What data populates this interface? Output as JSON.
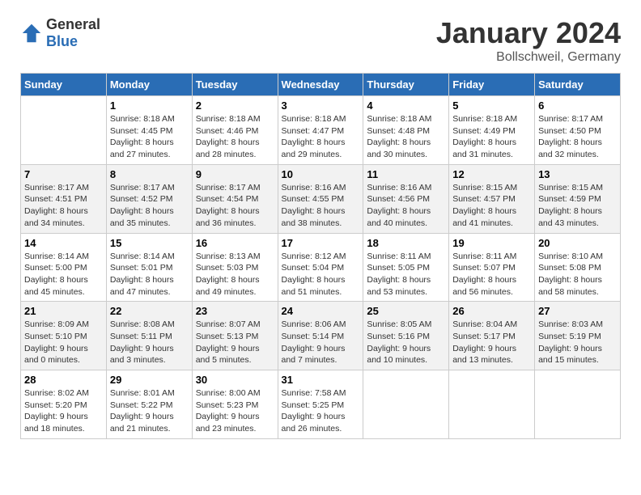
{
  "header": {
    "logo_general": "General",
    "logo_blue": "Blue",
    "title": "January 2024",
    "subtitle": "Bollschweil, Germany"
  },
  "days_of_week": [
    "Sunday",
    "Monday",
    "Tuesday",
    "Wednesday",
    "Thursday",
    "Friday",
    "Saturday"
  ],
  "weeks": [
    [
      {
        "day": "",
        "info": ""
      },
      {
        "day": "1",
        "info": "Sunrise: 8:18 AM\nSunset: 4:45 PM\nDaylight: 8 hours\nand 27 minutes."
      },
      {
        "day": "2",
        "info": "Sunrise: 8:18 AM\nSunset: 4:46 PM\nDaylight: 8 hours\nand 28 minutes."
      },
      {
        "day": "3",
        "info": "Sunrise: 8:18 AM\nSunset: 4:47 PM\nDaylight: 8 hours\nand 29 minutes."
      },
      {
        "day": "4",
        "info": "Sunrise: 8:18 AM\nSunset: 4:48 PM\nDaylight: 8 hours\nand 30 minutes."
      },
      {
        "day": "5",
        "info": "Sunrise: 8:18 AM\nSunset: 4:49 PM\nDaylight: 8 hours\nand 31 minutes."
      },
      {
        "day": "6",
        "info": "Sunrise: 8:17 AM\nSunset: 4:50 PM\nDaylight: 8 hours\nand 32 minutes."
      }
    ],
    [
      {
        "day": "7",
        "info": ""
      },
      {
        "day": "8",
        "info": "Sunrise: 8:17 AM\nSunset: 4:52 PM\nDaylight: 8 hours\nand 35 minutes."
      },
      {
        "day": "9",
        "info": "Sunrise: 8:17 AM\nSunset: 4:54 PM\nDaylight: 8 hours\nand 36 minutes."
      },
      {
        "day": "10",
        "info": "Sunrise: 8:16 AM\nSunset: 4:55 PM\nDaylight: 8 hours\nand 38 minutes."
      },
      {
        "day": "11",
        "info": "Sunrise: 8:16 AM\nSunset: 4:56 PM\nDaylight: 8 hours\nand 40 minutes."
      },
      {
        "day": "12",
        "info": "Sunrise: 8:15 AM\nSunset: 4:57 PM\nDaylight: 8 hours\nand 41 minutes."
      },
      {
        "day": "13",
        "info": "Sunrise: 8:15 AM\nSunset: 4:59 PM\nDaylight: 8 hours\nand 43 minutes."
      }
    ],
    [
      {
        "day": "14",
        "info": "Sunrise: 8:14 AM\nSunset: 5:00 PM\nDaylight: 8 hours\nand 45 minutes."
      },
      {
        "day": "15",
        "info": "Sunrise: 8:14 AM\nSunset: 5:01 PM\nDaylight: 8 hours\nand 47 minutes."
      },
      {
        "day": "16",
        "info": "Sunrise: 8:13 AM\nSunset: 5:03 PM\nDaylight: 8 hours\nand 49 minutes."
      },
      {
        "day": "17",
        "info": "Sunrise: 8:12 AM\nSunset: 5:04 PM\nDaylight: 8 hours\nand 51 minutes."
      },
      {
        "day": "18",
        "info": "Sunrise: 8:11 AM\nSunset: 5:05 PM\nDaylight: 8 hours\nand 53 minutes."
      },
      {
        "day": "19",
        "info": "Sunrise: 8:11 AM\nSunset: 5:07 PM\nDaylight: 8 hours\nand 56 minutes."
      },
      {
        "day": "20",
        "info": "Sunrise: 8:10 AM\nSunset: 5:08 PM\nDaylight: 8 hours\nand 58 minutes."
      }
    ],
    [
      {
        "day": "21",
        "info": "Sunrise: 8:09 AM\nSunset: 5:10 PM\nDaylight: 9 hours\nand 0 minutes."
      },
      {
        "day": "22",
        "info": "Sunrise: 8:08 AM\nSunset: 5:11 PM\nDaylight: 9 hours\nand 3 minutes."
      },
      {
        "day": "23",
        "info": "Sunrise: 8:07 AM\nSunset: 5:13 PM\nDaylight: 9 hours\nand 5 minutes."
      },
      {
        "day": "24",
        "info": "Sunrise: 8:06 AM\nSunset: 5:14 PM\nDaylight: 9 hours\nand 7 minutes."
      },
      {
        "day": "25",
        "info": "Sunrise: 8:05 AM\nSunset: 5:16 PM\nDaylight: 9 hours\nand 10 minutes."
      },
      {
        "day": "26",
        "info": "Sunrise: 8:04 AM\nSunset: 5:17 PM\nDaylight: 9 hours\nand 13 minutes."
      },
      {
        "day": "27",
        "info": "Sunrise: 8:03 AM\nSunset: 5:19 PM\nDaylight: 9 hours\nand 15 minutes."
      }
    ],
    [
      {
        "day": "28",
        "info": "Sunrise: 8:02 AM\nSunset: 5:20 PM\nDaylight: 9 hours\nand 18 minutes."
      },
      {
        "day": "29",
        "info": "Sunrise: 8:01 AM\nSunset: 5:22 PM\nDaylight: 9 hours\nand 21 minutes."
      },
      {
        "day": "30",
        "info": "Sunrise: 8:00 AM\nSunset: 5:23 PM\nDaylight: 9 hours\nand 23 minutes."
      },
      {
        "day": "31",
        "info": "Sunrise: 7:58 AM\nSunset: 5:25 PM\nDaylight: 9 hours\nand 26 minutes."
      },
      {
        "day": "",
        "info": ""
      },
      {
        "day": "",
        "info": ""
      },
      {
        "day": "",
        "info": ""
      }
    ]
  ]
}
